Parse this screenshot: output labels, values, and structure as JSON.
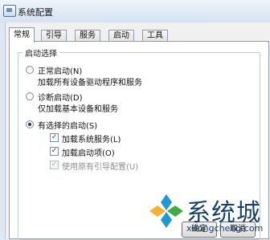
{
  "window": {
    "title": "系统配置"
  },
  "tabs": [
    {
      "label": "常规",
      "active": true
    },
    {
      "label": "引导",
      "active": false
    },
    {
      "label": "服务",
      "active": false
    },
    {
      "label": "启动",
      "active": false
    },
    {
      "label": "工具",
      "active": false
    }
  ],
  "startup_selection": {
    "legend": "启动选择",
    "normal": {
      "label": "正常启动(N)",
      "desc": "加载所有设备驱动程序和服务",
      "selected": false
    },
    "diagnostic": {
      "label": "诊断启动(D)",
      "desc": "仅加载基本设备和服务",
      "selected": false
    },
    "selective": {
      "label": "有选择的启动(S)",
      "selected": true,
      "options": [
        {
          "label": "加载系统服务(L)",
          "checked": true,
          "enabled": true
        },
        {
          "label": "加载启动项(O)",
          "checked": true,
          "enabled": true
        },
        {
          "label": "使用原有引导配置(U)",
          "checked": true,
          "enabled": false
        }
      ]
    }
  },
  "buttons": {
    "ok": "确定",
    "cancel": "取消"
  },
  "watermark": {
    "brand": "系统城",
    "url": "xitongcheng.com"
  },
  "colors": {
    "titlebar": "#dfe8f2",
    "brand": "#17426c"
  }
}
